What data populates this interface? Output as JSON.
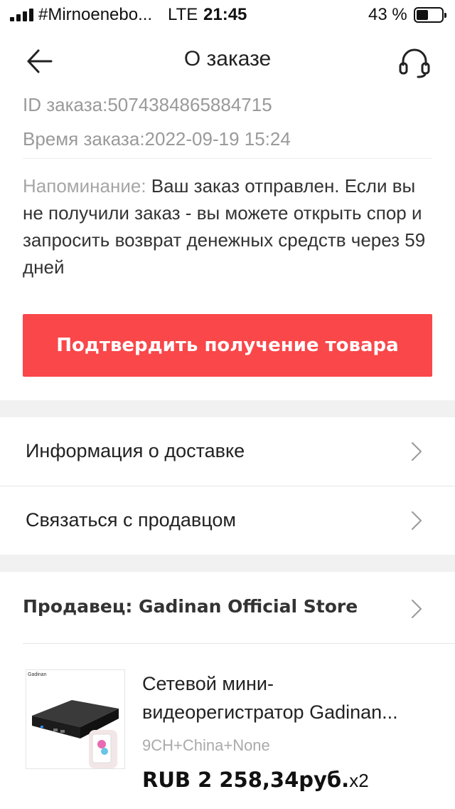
{
  "status_bar": {
    "carrier": "#Mirnoenebo...",
    "network": "LTE",
    "time": "21:45",
    "battery": "43 %"
  },
  "header": {
    "title": "О заказе",
    "back_icon": "arrow-left-icon",
    "support_icon": "headset-icon"
  },
  "order": {
    "id_text": "ID заказа:5074384865884715",
    "time_text": "Время заказа:2022-09-19 15:24",
    "reminder_label": "Напоминание:",
    "reminder_text": " Ваш заказ отправлен. Если вы не получили заказ - вы можете открыть спор и запросить возврат денежных средств через 59 дней"
  },
  "actions": {
    "confirm_label": "Подтвердить получение товара"
  },
  "menu": {
    "delivery_info": "Информация о доставке",
    "contact_seller": "Связаться с продавцом"
  },
  "seller": {
    "label": "Продавец: Gadinan Official Store"
  },
  "product": {
    "name": "Сетевой мини-видеорегистратор Gadinan...",
    "variant": "9CH+China+None",
    "price": "RUB 2 258,34руб.",
    "quantity": "x2",
    "brand_logo": "Gadinan"
  },
  "colors": {
    "accent": "#f9474a",
    "muted_text": "#9a9a9a",
    "band": "#f1f1f1"
  }
}
